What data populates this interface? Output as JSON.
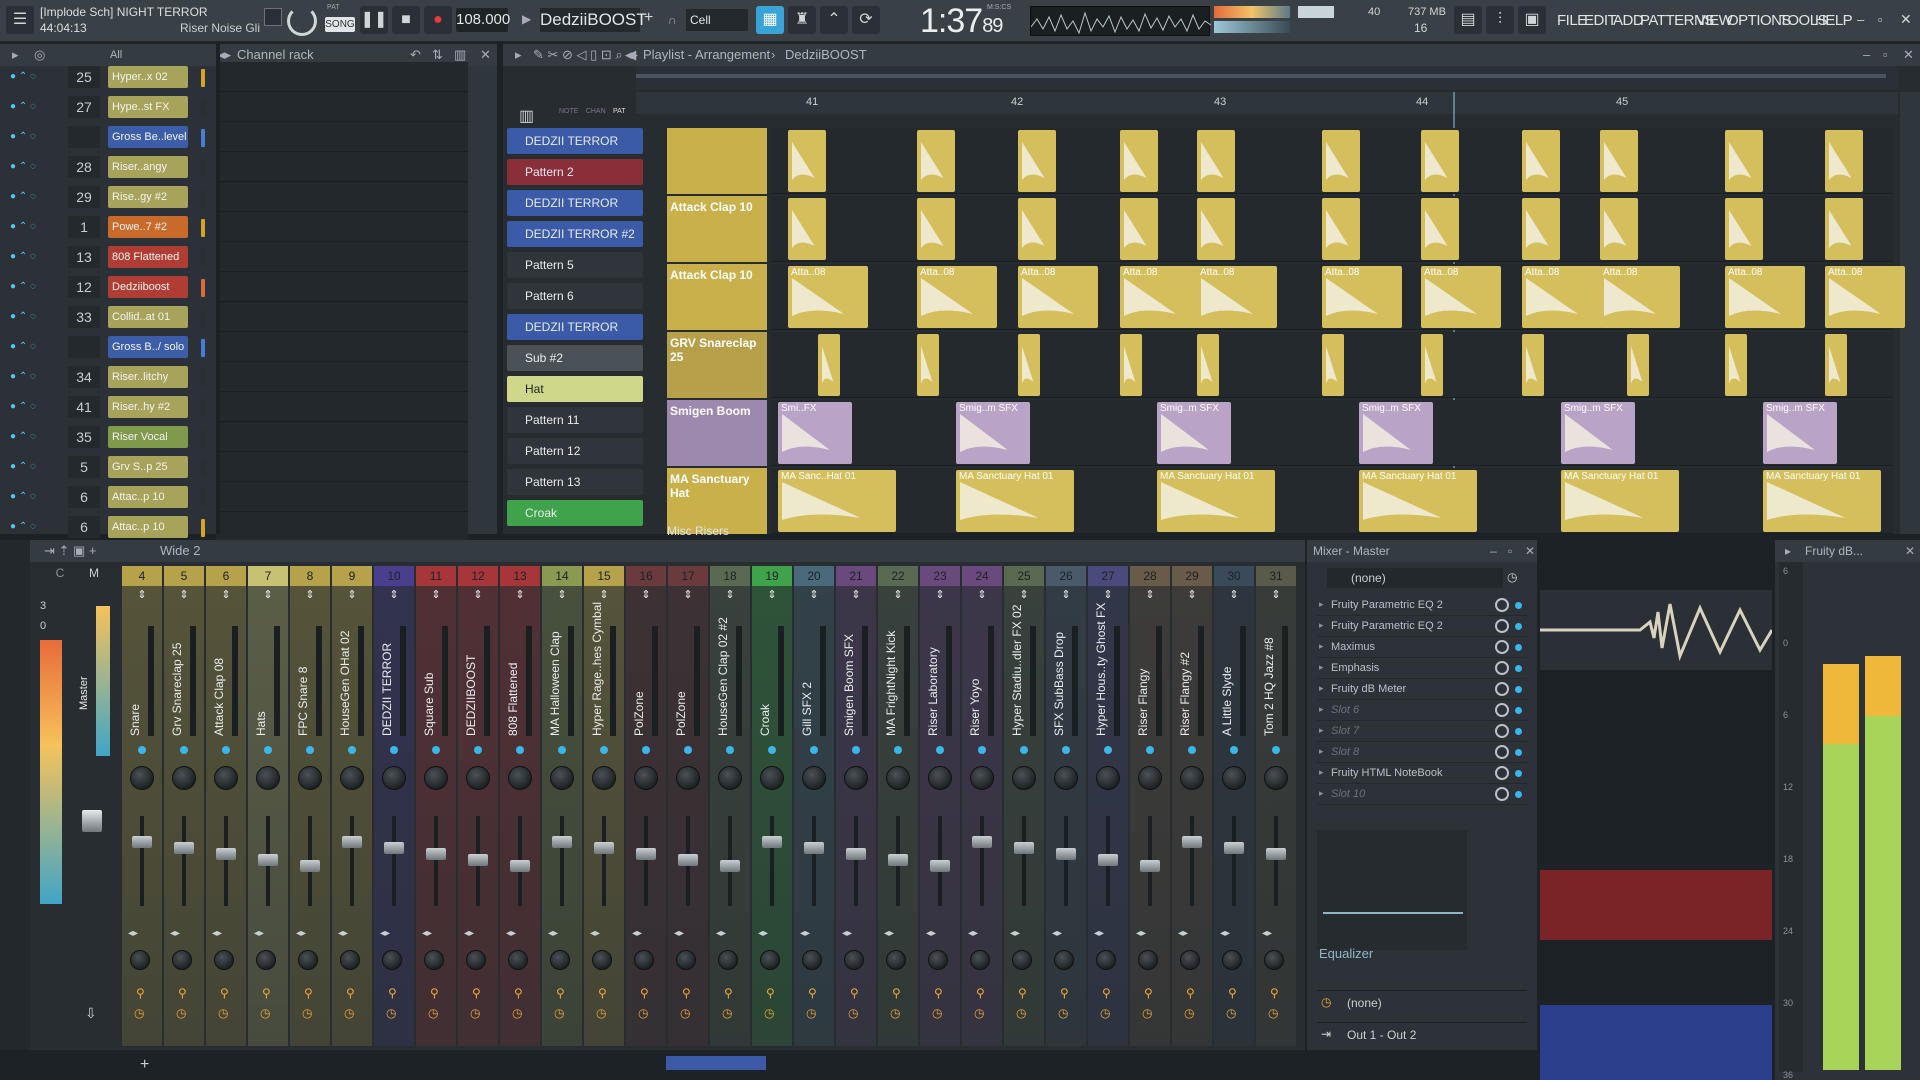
{
  "topbar": {
    "project": "[Implode Sch] NIGHT TERROR",
    "time_display": "44:04:13",
    "hint": "Riser Noise Gli",
    "pat_label": "PAT",
    "song_label": "SONG",
    "tempo": "108.000",
    "pattern_name": "DedziiBOOST",
    "snap": "Cell",
    "clock": "1:37",
    "clock_sub": "89",
    "clock_unit": "M:S:CS",
    "cpu_value": "40",
    "mem_value": "737 MB",
    "poly_value": "16",
    "menu": [
      "FILE",
      "EDIT",
      "ADD",
      "PATTERNS",
      "VIEW",
      "OPTIONS",
      "TOOLS",
      "HELP"
    ]
  },
  "channel_rack": {
    "title": "Channel rack",
    "filter": "All",
    "channels": [
      {
        "num": "25",
        "name": "Hyper..x 02",
        "color": "#a7a35a",
        "sel": "#d4a32c"
      },
      {
        "num": "27",
        "name": "Hype..st FX",
        "color": "#a7a35a",
        "sel": "#2a2f33"
      },
      {
        "num": "",
        "name": "Gross Be..level",
        "color": "#3c5ea8",
        "sel": "#4a7cd6"
      },
      {
        "num": "28",
        "name": "Riser..angy",
        "color": "#a7a35a",
        "sel": "#2a2f33"
      },
      {
        "num": "29",
        "name": "Rise..gy #2",
        "color": "#a7a35a",
        "sel": "#2a2f33"
      },
      {
        "num": "1",
        "name": "Powe..7 #2",
        "color": "#c76a2a",
        "sel": "#d4a32c"
      },
      {
        "num": "13",
        "name": "808 Flattened",
        "color": "#b03d33",
        "sel": "#2a2f33"
      },
      {
        "num": "12",
        "name": "Dedziiboost",
        "color": "#b03d33",
        "sel": "#d96a3a"
      },
      {
        "num": "33",
        "name": "Collid..at 01",
        "color": "#a7a35a",
        "sel": "#2a2f33"
      },
      {
        "num": "",
        "name": "Gross B../ solo",
        "color": "#3c5ea8",
        "sel": "#4a7cd6"
      },
      {
        "num": "34",
        "name": "Riser..litchy",
        "color": "#a7a35a",
        "sel": "#2a2f33"
      },
      {
        "num": "41",
        "name": "Riser..hy #2",
        "color": "#a7a35a",
        "sel": "#2a2f33"
      },
      {
        "num": "35",
        "name": "Riser Vocal",
        "color": "#7f9a4a",
        "sel": "#2a2f33"
      },
      {
        "num": "5",
        "name": "Grv S..p 25",
        "color": "#a7a35a",
        "sel": "#2a2f33"
      },
      {
        "num": "6",
        "name": "Attac..p 10",
        "color": "#a7a35a",
        "sel": "#2a2f33"
      },
      {
        "num": "6",
        "name": "Attac..p 10",
        "color": "#a7a35a",
        "sel": "#d4a32c"
      }
    ]
  },
  "playlist": {
    "title": "Playlist - Arrangement",
    "pattern": "DedziiBOOST",
    "ruler": [
      "41",
      "42",
      "43",
      "44",
      "45"
    ],
    "tabs": [
      "NOTE",
      "CHAN",
      "PAT"
    ],
    "patterns": [
      {
        "name": "DEDZII TERROR",
        "color": "#3b5aa8"
      },
      {
        "name": "Pattern 2",
        "color": "#8a2f3a"
      },
      {
        "name": "DEDZII TERROR",
        "color": "#3b5aa8"
      },
      {
        "name": "DEDZII TERROR #2",
        "color": "#3b5aa8"
      },
      {
        "name": "Pattern 5",
        "color": "#2f353a"
      },
      {
        "name": "Pattern 6",
        "color": "#2f353a"
      },
      {
        "name": "DEDZII TERROR",
        "color": "#3b5aa8"
      },
      {
        "name": "Sub #2",
        "color": "#4a5258"
      },
      {
        "name": "Hat",
        "color": "#cfd88a"
      },
      {
        "name": "Pattern 11",
        "color": "#2f353a"
      },
      {
        "name": "Pattern 12",
        "color": "#2f353a"
      },
      {
        "name": "Pattern 13",
        "color": "#2f353a"
      },
      {
        "name": "Croak",
        "color": "#3ea34a"
      }
    ],
    "tracks": [
      {
        "name": "",
        "color": "#c9b04a"
      },
      {
        "name": "Attack Clap 10",
        "color": "#c9b04a"
      },
      {
        "name": "Attack Clap 10",
        "color": "#c9b04a"
      },
      {
        "name": "GRV Snareclap 25",
        "color": "#b8a04a"
      },
      {
        "name": "Smigen Boom",
        "color": "#a58fb3"
      },
      {
        "name": "MA Sanctuary Hat",
        "color": "#c9b04a"
      }
    ],
    "misc_track": "Misc Risers",
    "clip_labels": {
      "atta": "Atta..08",
      "smig": "Smig..m SFX",
      "smig_first": "Smi..FX",
      "hat": "MA Sanctuary Hat 01",
      "hat_first": "MA Sanc..Hat 01"
    }
  },
  "mixer": {
    "title": "Mixer - Master",
    "preset": "Wide 2",
    "master_label": "Master",
    "master_letter": "M",
    "current_letter": "C",
    "strips": [
      {
        "num": "4",
        "name": "Snare",
        "color": "#b5a24a"
      },
      {
        "num": "5",
        "name": "Grv Snareclap 25",
        "color": "#b5a24a"
      },
      {
        "num": "6",
        "name": "Attack Clap 08",
        "color": "#b5a24a"
      },
      {
        "num": "7",
        "name": "Hats",
        "color": "#c6c272"
      },
      {
        "num": "8",
        "name": "FPC Snare 8",
        "color": "#b5a24a"
      },
      {
        "num": "9",
        "name": "HouseGen OHat 02",
        "color": "#b5a24a"
      },
      {
        "num": "10",
        "name": "DEDZII TERROR",
        "color": "#4a3f8c"
      },
      {
        "num": "11",
        "name": "Square Sub",
        "color": "#a7363a"
      },
      {
        "num": "12",
        "name": "DEDZIIBOOST",
        "color": "#a7363a"
      },
      {
        "num": "13",
        "name": "808 Flattened",
        "color": "#a7363a"
      },
      {
        "num": "14",
        "name": "MA Halloween Clap",
        "color": "#8a9a52"
      },
      {
        "num": "15",
        "name": "Hyper Rage..hes Cymbal",
        "color": "#b5a24a"
      },
      {
        "num": "16",
        "name": "PolZone",
        "color": "#6a3a3c"
      },
      {
        "num": "17",
        "name": "PolZone",
        "color": "#6a3a3c"
      },
      {
        "num": "18",
        "name": "HouseGen Clap 02 #2",
        "color": "#5a6a52"
      },
      {
        "num": "19",
        "name": "Croak",
        "color": "#3ea34a"
      },
      {
        "num": "20",
        "name": "Gill SFX 2",
        "color": "#4a6a7c"
      },
      {
        "num": "21",
        "name": "Smigen Boom SFX",
        "color": "#6a4a7c"
      },
      {
        "num": "22",
        "name": "MA FrightNight Kick",
        "color": "#5a6a52"
      },
      {
        "num": "23",
        "name": "Riser Laboratory",
        "color": "#6a4a7c"
      },
      {
        "num": "24",
        "name": "Riser Yoyo",
        "color": "#6a4a7c"
      },
      {
        "num": "25",
        "name": "Hyper Stadiu..dler FX 02",
        "color": "#5a6a52"
      },
      {
        "num": "26",
        "name": "SFX SubBass Drop",
        "color": "#4a5a6a"
      },
      {
        "num": "27",
        "name": "Hyper Hous..ty Ghost FX",
        "color": "#4a4a7c"
      },
      {
        "num": "28",
        "name": "Riser Flangy",
        "color": "#6a5a4a"
      },
      {
        "num": "29",
        "name": "Riser Flangy #2",
        "color": "#6a5a4a"
      },
      {
        "num": "30",
        "name": "A Little Slyde",
        "color": "#3a4a5a"
      },
      {
        "num": "31",
        "name": "Tom 2 HQ Jazz #8",
        "color": "#5a5a4a"
      }
    ],
    "master_numbers": [
      "3",
      "0"
    ],
    "insert_preset": "(none)",
    "slots": [
      {
        "name": "Fruity Parametric EQ 2",
        "active": true
      },
      {
        "name": "Fruity Parametric EQ 2",
        "active": true
      },
      {
        "name": "Maximus",
        "active": true
      },
      {
        "name": "Emphasis",
        "active": true
      },
      {
        "name": "Fruity dB Meter",
        "active": true
      },
      {
        "name": "Slot 6",
        "active": false
      },
      {
        "name": "Slot 7",
        "active": false
      },
      {
        "name": "Slot 8",
        "active": false
      },
      {
        "name": "Fruity HTML NoteBook",
        "active": true
      },
      {
        "name": "Slot 10",
        "active": false
      }
    ],
    "eq_label": "Equalizer",
    "sidechain": "(none)",
    "output": "Out 1 - Out 2"
  },
  "dbmeter": {
    "title": "Fruity dB...",
    "scale": [
      "6",
      "0",
      "6",
      "12",
      "18",
      "24",
      "30",
      "36"
    ]
  }
}
